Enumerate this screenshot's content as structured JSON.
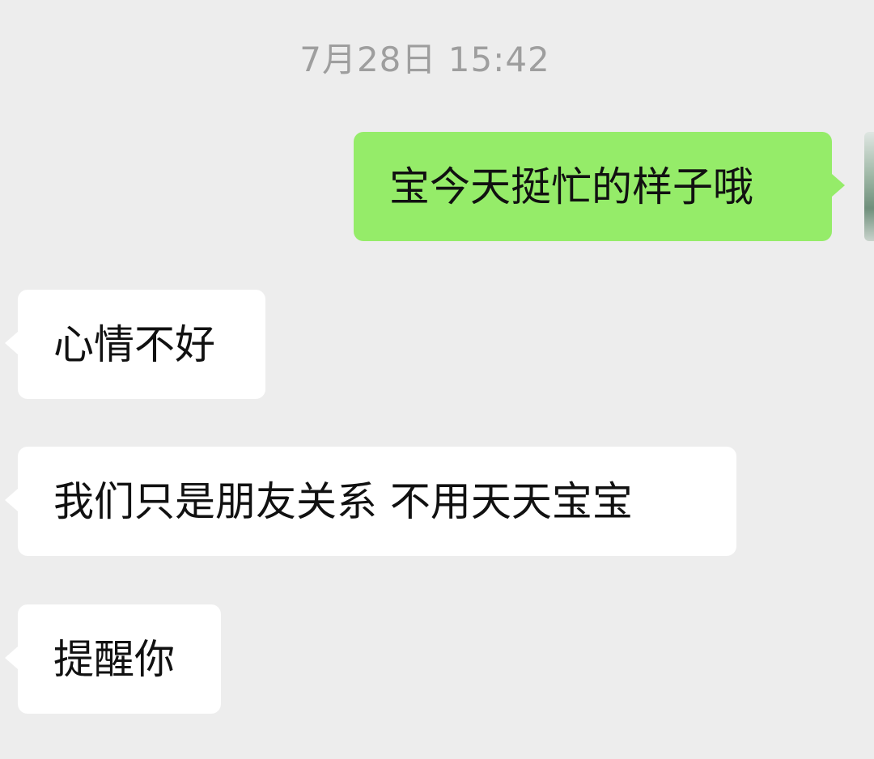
{
  "chat": {
    "timestamp": "7月28日 15:42",
    "messages": [
      {
        "direction": "sent",
        "text": "宝今天挺忙的样子哦"
      },
      {
        "direction": "received",
        "text": "心情不好"
      },
      {
        "direction": "received",
        "text": "我们只是朋友关系 不用天天宝宝"
      },
      {
        "direction": "received",
        "text": "提醒你"
      }
    ]
  },
  "colors": {
    "background": "#ededed",
    "sent_bubble": "#95ec69",
    "received_bubble": "#ffffff",
    "timestamp_text": "#9e9e9e",
    "message_text": "#111111"
  }
}
